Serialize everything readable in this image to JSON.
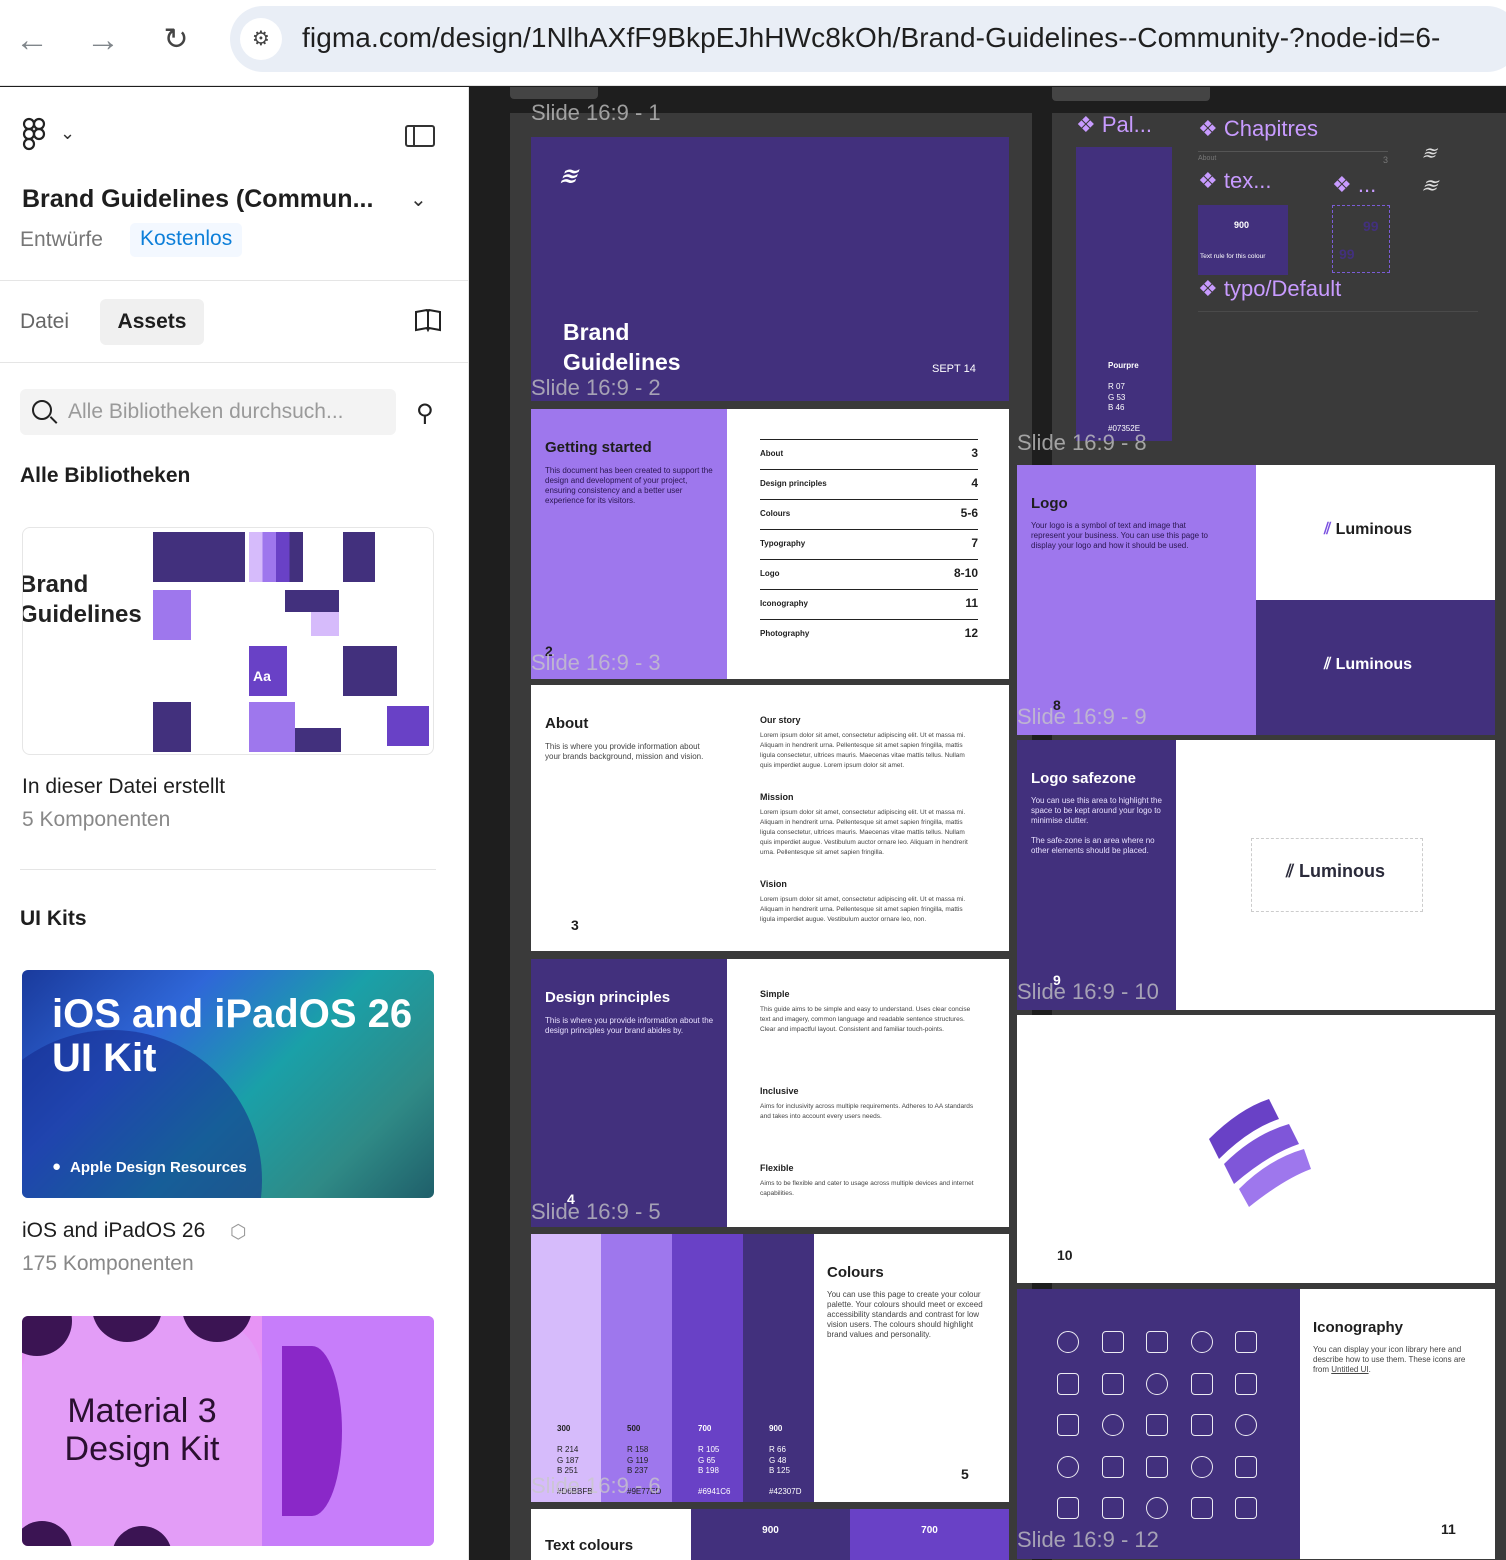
{
  "browser": {
    "back": "←",
    "forward": "→",
    "reload": "↻",
    "url": "figma.com/design/1NlhAXfF9BkpEJhHWc8kOh/Brand-Guidelines--Community-?node-id=6-"
  },
  "sidebar": {
    "file_title": "Brand Guidelines (Commun...",
    "project": "Entwürfe",
    "plan_badge": "Kostenlos",
    "tabs": [
      {
        "label": "Datei"
      },
      {
        "label": "Assets"
      }
    ],
    "search_placeholder": "Alle Bibliotheken durchsuch...",
    "section_all": "Alle Bibliotheken",
    "lib_thumb_text": "Brand Guidelines",
    "lib_thumb_text_line1": "Brand",
    "lib_thumb_text_line2": "Guidelines",
    "lib_thumb_aa": "Aa",
    "lib_name": "In dieser Datei erstellt",
    "lib_count": "5 Komponenten",
    "section_uikits": "UI Kits",
    "ios_thumb_title_1": "iOS and iPadOS 26",
    "ios_thumb_title_2": "UI Kit",
    "ios_thumb_brand": "Apple Design Resources",
    "ios_name": "iOS and iPadOS 26",
    "ios_count": "175 Komponenten",
    "material_title_1": "Material 3",
    "material_title_2": "Design Kit"
  },
  "canvas": {
    "slide_labels": [
      "Slide 16:9 - 1",
      "Slide 16:9 - 2",
      "Slide 16:9 - 3",
      "Slide 16:9 - 5",
      "Slide 16:9 - 6",
      "Slide 16:9 - 8",
      "Slide 16:9 - 9",
      "Slide 16:9 - 10",
      "Slide 16:9 - 12"
    ],
    "cover": {
      "title_1": "Brand",
      "title_2": "Guidelines",
      "date": "SEPT 14"
    },
    "getting_started": {
      "title": "Getting started",
      "body": "This document has been created to support the design and development of your project, ensuring consistency and a better user experience for its visitors.",
      "page": "2",
      "toc": [
        {
          "label": "About",
          "page": "3"
        },
        {
          "label": "Design principles",
          "page": "4"
        },
        {
          "label": "Colours",
          "page": "5-6"
        },
        {
          "label": "Typography",
          "page": "7"
        },
        {
          "label": "Logo",
          "page": "8-10"
        },
        {
          "label": "Iconography",
          "page": "11"
        },
        {
          "label": "Photography",
          "page": "12"
        }
      ]
    },
    "about": {
      "title": "About",
      "body": "This is where you provide information about your brands background, mission and vision.",
      "page": "3",
      "sections": [
        {
          "title": "Our story",
          "body": "Lorem ipsum dolor sit amet, consectetur adipiscing elit. Ut et massa mi. Aliquam in hendrerit urna. Pellentesque sit amet sapien fringilla, mattis ligula consectetur, ultrices mauris. Maecenas vitae mattis tellus. Nullam quis imperdiet augue. Lorem ipsum dolor sit amet."
        },
        {
          "title": "Mission",
          "body": "Lorem ipsum dolor sit amet, consectetur adipiscing elit. Ut et massa mi. Aliquam in hendrerit urna. Pellentesque sit amet sapien fringilla, mattis ligula consectetur, ultrices mauris. Maecenas vitae mattis tellus. Nullam quis imperdiet augue. Vestibulum auctor ornare leo. Aliquam in hendrerit urna. Pellentesque sit amet sapien fringilla."
        },
        {
          "title": "Vision",
          "body": "Lorem ipsum dolor sit amet, consectetur adipiscing elit. Ut et massa mi. Aliquam in hendrerit urna. Pellentesque sit amet sapien fringilla, mattis ligula imperdiet augue. Vestibulum auctor ornare leo, non."
        }
      ]
    },
    "principles": {
      "title": "Design principles",
      "body": "This is where you provide information about the design principles your brand abides by.",
      "page": "4",
      "items": [
        {
          "title": "Simple",
          "body": "This guide aims to be simple and easy to understand. Uses clear concise text and imagery, common language and readable sentence structures. Clear and impactful layout. Consistent and familiar touch-points."
        },
        {
          "title": "Inclusive",
          "body": "Aims for inclusivity across multiple requirements. Adheres to AA standards and takes into account every users needs."
        },
        {
          "title": "Flexible",
          "body": "Aims to be flexible and cater to usage across multiple devices and internet capabilities."
        }
      ]
    },
    "colours": {
      "title": "Colours",
      "body": "You can use this page to create your colour palette. Your colours should meet or exceed accessibility standards and contrast for low vision users. The colours should highlight brand values and personality.",
      "page": "5",
      "swatches": [
        {
          "name": "300",
          "r": "R  214",
          "g": "G  187",
          "b": "B  251",
          "hex": "#D6BBFB",
          "color": "#d6bbfb"
        },
        {
          "name": "500",
          "r": "R  158",
          "g": "G  119",
          "b": "B  237",
          "hex": "#9E77ED",
          "color": "#9e77ed"
        },
        {
          "name": "700",
          "r": "R  105",
          "g": "G  65",
          "b": "B  198",
          "hex": "#6941C6",
          "color": "#6941c6"
        },
        {
          "name": "900",
          "r": "R  66",
          "g": "G  48",
          "b": "B  125",
          "hex": "#42307D",
          "color": "#42307d"
        }
      ]
    },
    "text_colours": {
      "title": "Text colours",
      "c1": "900",
      "c2": "700"
    },
    "components": {
      "pal": "Pal...",
      "chapitres": "Chapitres",
      "tex": "tex...",
      "dots": "...",
      "typo": "typo/Default",
      "tile_900": "900",
      "tile_text": "Text rule for this colour",
      "about_lbl": "About",
      "about_num": "3",
      "nn": "99",
      "pourpre": {
        "name": "Pourpre",
        "r": "R  07",
        "g": "G  53",
        "b": "B  46",
        "hex": "#07352E"
      }
    },
    "logo": {
      "title": "Logo",
      "body": "Your logo is a symbol of text and image that represent your business. You can use this page to display your logo and how it should be used.",
      "brand": "Luminous",
      "page": "8"
    },
    "safezone": {
      "title": "Logo safezone",
      "body1": "You can use this area to highlight the space to be kept around your logo to minimise clutter.",
      "body2": "The safe-zone is an area where no other elements should be placed.",
      "brand": "Luminous",
      "page": "9"
    },
    "mark_page": "10",
    "iconography": {
      "title": "Iconography",
      "body": "You can display your icon library here and describe how to use them. These icons are from",
      "link": "Untitled UI",
      "page": "11"
    }
  },
  "colors": {
    "purple_dark": "#42307d",
    "purple_mid": "#6941c6",
    "purple_light": "#9e77ed",
    "purple_pale": "#d6bbfb",
    "accent_blue": "#0d99ff"
  }
}
